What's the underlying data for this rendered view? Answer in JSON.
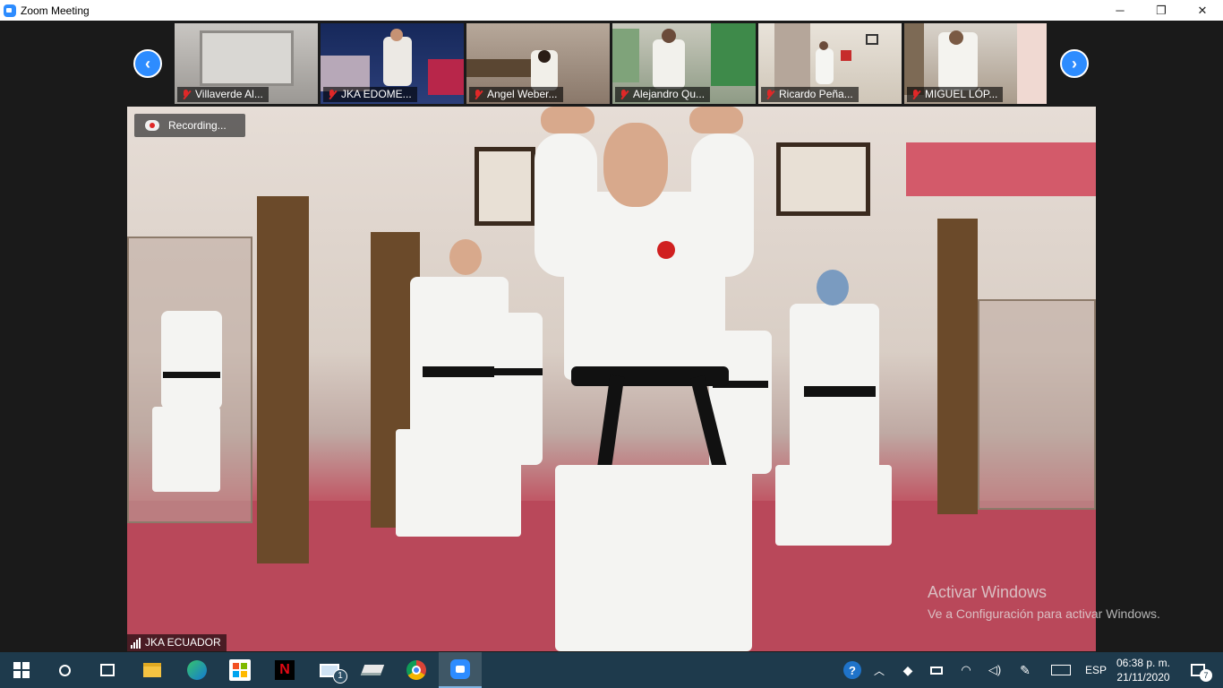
{
  "window": {
    "title": "Zoom Meeting",
    "minimize_glyph": "─",
    "restore_glyph": "❐",
    "close_glyph": "✕"
  },
  "gallery": {
    "prev_glyph": "‹",
    "next_glyph": "›",
    "participants": [
      {
        "name": "Villaverde Al...",
        "muted": true
      },
      {
        "name": "JKA EDOME...",
        "muted": true
      },
      {
        "name": "Angel Weber...",
        "muted": true
      },
      {
        "name": "Alejandro Qu...",
        "muted": true
      },
      {
        "name": "Ricardo Peña...",
        "muted": true
      },
      {
        "name": "MIGUEL LÓP...",
        "muted": true
      }
    ]
  },
  "main_video": {
    "recording_text": "Recording...",
    "speaker_name": "JKA ECUADOR"
  },
  "watermark": {
    "title": "Activar Windows",
    "subtitle": "Ve a Configuración para activar Windows."
  },
  "taskbar": {
    "apps": [
      "start-icon",
      "search-icon",
      "task-view-icon",
      "file-explorer-icon",
      "edge-icon",
      "store-icon",
      "netflix-icon",
      "mail-icon",
      "stack-icon",
      "chrome-icon",
      "zoom-icon"
    ],
    "mail_badge": "1",
    "language": "ESP",
    "time": "06:38 p. m.",
    "date": "21/11/2020",
    "notification_count": "7"
  },
  "colors": {
    "zoom_blue": "#2d8cff",
    "taskbar": "#1e3a4c",
    "muted_red": "#e02828"
  }
}
